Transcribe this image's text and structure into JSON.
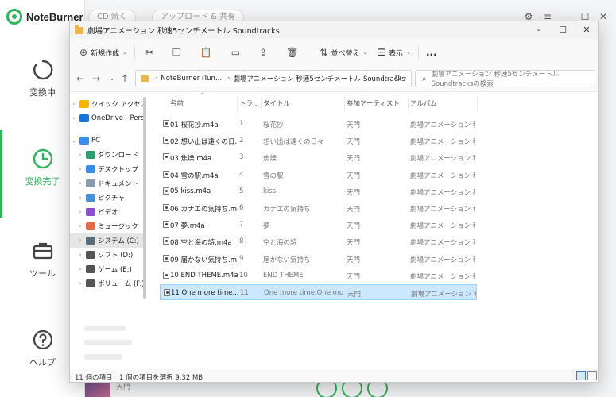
{
  "noteburner": {
    "app_name": "NoteBurner",
    "nav": [
      {
        "label": "変換中",
        "icon": "spinner-icon"
      },
      {
        "label": "変換完了",
        "icon": "clock-icon",
        "active": true
      },
      {
        "label": "ツール",
        "icon": "toolbox-icon"
      },
      {
        "label": "ヘルプ",
        "icon": "help-icon"
      }
    ],
    "top_buttons": [
      "CD 焼く",
      "アップロード & 共有"
    ],
    "bottom_artist": "天門",
    "accent": "#2fb35b"
  },
  "explorer": {
    "title": "劇場アニメーション 秒速5センチメートル Soundtracks",
    "commands": {
      "new": "新規作成",
      "sort": "並べ替え",
      "view": "表示",
      "more": "..."
    },
    "address": {
      "crumbs": [
        "NoteBurner iTun...",
        "劇場アニメーション 秒速5センチメートル Soundtracks"
      ],
      "search_placeholder": "劇場アニメーション 秒速5センチメートル Soundtracksの検索"
    },
    "tree": [
      {
        "label": "クイック アクセス",
        "icon": "star-icon",
        "color": "#f2b600",
        "chev": "›"
      },
      {
        "label": "OneDrive - Persor",
        "icon": "cloud-icon",
        "color": "#1a73d9",
        "chev": "›"
      },
      {
        "label": "PC",
        "icon": "pc-icon",
        "color": "#3a8ee6",
        "chev": "⌄"
      },
      {
        "label": "ダウンロード",
        "icon": "download-icon",
        "color": "#2f9e6f",
        "chev": "›"
      },
      {
        "label": "デスクトップ",
        "icon": "desktop-icon",
        "color": "#3a8ee6",
        "chev": "›"
      },
      {
        "label": "ドキュメント",
        "icon": "document-icon",
        "color": "#8a9bb0",
        "chev": "›"
      },
      {
        "label": "ピクチャ",
        "icon": "picture-icon",
        "color": "#4a90d9",
        "chev": "›"
      },
      {
        "label": "ビデオ",
        "icon": "video-icon",
        "color": "#8a4fcf",
        "chev": "›"
      },
      {
        "label": "ミュージック",
        "icon": "music-icon",
        "color": "#e06a4a",
        "chev": "›"
      },
      {
        "label": "システム (C:)",
        "icon": "drive-icon",
        "color": "#5a6b7a",
        "chev": "›",
        "selected": true
      },
      {
        "label": "ソフト (D:)",
        "icon": "drive-icon",
        "color": "#555",
        "chev": "›"
      },
      {
        "label": "ゲーム (E:)",
        "icon": "drive-icon",
        "color": "#555",
        "chev": "›"
      },
      {
        "label": "ボリューム (F:)",
        "icon": "drive-icon",
        "color": "#555",
        "chev": "›"
      }
    ],
    "columns": [
      "名前",
      "トラ...",
      "タイトル",
      "参加アーティスト",
      "アルバム"
    ],
    "files": [
      {
        "name": "01 桜花抄.m4a",
        "track": "1",
        "title": "桜花抄",
        "artist": "天門",
        "album": "劇場アニメーション 秒..."
      },
      {
        "name": "02 想い出は遠くの日...",
        "track": "2",
        "title": "想い出は遠くの日々",
        "artist": "天門",
        "album": "劇場アニメーション 秒..."
      },
      {
        "name": "03 焦燥.m4a",
        "track": "3",
        "title": "焦燥",
        "artist": "天門",
        "album": "劇場アニメーション 秒..."
      },
      {
        "name": "04 雪の駅.m4a",
        "track": "4",
        "title": "雪の駅",
        "artist": "天門",
        "album": "劇場アニメーション 秒..."
      },
      {
        "name": "05 kiss.m4a",
        "track": "5",
        "title": "kiss",
        "artist": "天門",
        "album": "劇場アニメーション 秒..."
      },
      {
        "name": "06 カナエの気持ち.m4a",
        "track": "6",
        "title": "カナエの気持ち",
        "artist": "天門",
        "album": "劇場アニメーション 秒..."
      },
      {
        "name": "07 夢.m4a",
        "track": "7",
        "title": "夢",
        "artist": "天門",
        "album": "劇場アニメーション 秒..."
      },
      {
        "name": "08 空と海の詩.m4a",
        "track": "8",
        "title": "空と海の詩",
        "artist": "天門",
        "album": "劇場アニメーション 秒..."
      },
      {
        "name": "09 届かない気持ち.m...",
        "track": "9",
        "title": "届かない気持ち",
        "artist": "天門",
        "album": "劇場アニメーション 秒..."
      },
      {
        "name": "10 END THEME.m4a",
        "track": "10",
        "title": "END THEME",
        "artist": "天門",
        "album": "劇場アニメーション 秒..."
      },
      {
        "name": "11 One more time,...",
        "track": "11",
        "title": "One more time,One more...",
        "artist": "天門",
        "album": "劇場アニメーション 秒...",
        "selected": true
      }
    ],
    "status": {
      "count": "11 個の項目",
      "selection": "1 個の項目を選択 9.32 MB"
    }
  }
}
